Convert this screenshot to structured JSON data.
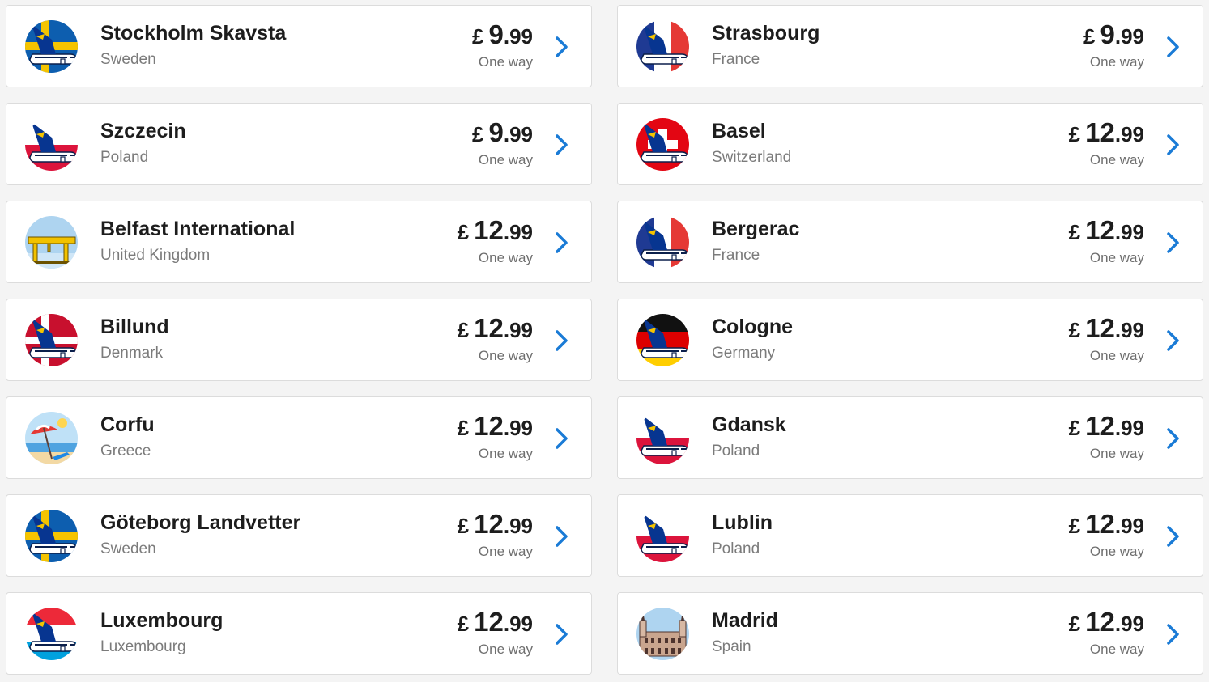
{
  "currency_symbol": "£",
  "price_label": "One way",
  "colors": {
    "accent": "#1a7bd6",
    "navy": "#073590",
    "card_bg": "#ffffff",
    "page_bg": "#f4f4f4"
  },
  "destinations": [
    {
      "city": "Stockholm Skavsta",
      "country": "Sweden",
      "price_int": "9",
      "price_dec": ".99",
      "icon": "plane-sweden-flag-icon",
      "theme": "sweden"
    },
    {
      "city": "Strasbourg",
      "country": "France",
      "price_int": "9",
      "price_dec": ".99",
      "icon": "plane-france-flag-icon",
      "theme": "france"
    },
    {
      "city": "Szczecin",
      "country": "Poland",
      "price_int": "9",
      "price_dec": ".99",
      "icon": "plane-poland-flag-icon",
      "theme": "poland"
    },
    {
      "city": "Basel",
      "country": "Switzerland",
      "price_int": "12",
      "price_dec": ".99",
      "icon": "plane-switzerland-flag-icon",
      "theme": "switzerland"
    },
    {
      "city": "Belfast International",
      "country": "United Kingdom",
      "price_int": "12",
      "price_dec": ".99",
      "icon": "cranes-icon",
      "theme": "belfast"
    },
    {
      "city": "Bergerac",
      "country": "France",
      "price_int": "12",
      "price_dec": ".99",
      "icon": "plane-france-flag-icon",
      "theme": "france"
    },
    {
      "city": "Billund",
      "country": "Denmark",
      "price_int": "12",
      "price_dec": ".99",
      "icon": "plane-denmark-flag-icon",
      "theme": "denmark"
    },
    {
      "city": "Cologne",
      "country": "Germany",
      "price_int": "12",
      "price_dec": ".99",
      "icon": "plane-germany-flag-icon",
      "theme": "germany"
    },
    {
      "city": "Corfu",
      "country": "Greece",
      "price_int": "12",
      "price_dec": ".99",
      "icon": "beach-umbrella-icon",
      "theme": "beach"
    },
    {
      "city": "Gdansk",
      "country": "Poland",
      "price_int": "12",
      "price_dec": ".99",
      "icon": "plane-poland-flag-icon",
      "theme": "poland"
    },
    {
      "city": "Göteborg Landvetter",
      "country": "Sweden",
      "price_int": "12",
      "price_dec": ".99",
      "icon": "plane-sweden-flag-icon",
      "theme": "sweden"
    },
    {
      "city": "Lublin",
      "country": "Poland",
      "price_int": "12",
      "price_dec": ".99",
      "icon": "plane-poland-flag-icon",
      "theme": "poland"
    },
    {
      "city": "Luxembourg",
      "country": "Luxembourg",
      "price_int": "12",
      "price_dec": ".99",
      "icon": "plane-luxembourg-flag-icon",
      "theme": "luxembourg"
    },
    {
      "city": "Madrid",
      "country": "Spain",
      "price_int": "12",
      "price_dec": ".99",
      "icon": "royal-palace-icon",
      "theme": "madrid"
    }
  ]
}
